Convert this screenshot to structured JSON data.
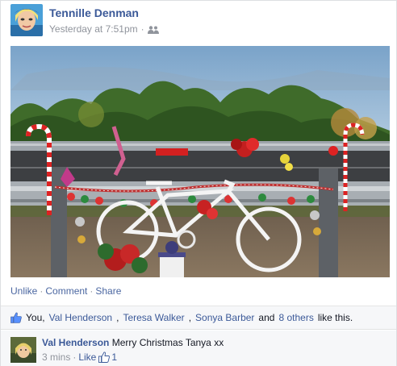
{
  "post": {
    "author": "Tennille Denman",
    "timestamp": "Yesterday at 7:51pm",
    "audience_separator": "·",
    "audience_icon": "friends-icon"
  },
  "actions": {
    "unlike": "Unlike",
    "comment": "Comment",
    "share": "Share",
    "separator": "·"
  },
  "likes": {
    "you": "You,",
    "people": [
      "Val Henderson",
      "Teresa Walker",
      "Sonya Barber"
    ],
    "and": "and",
    "others": "8 others",
    "suffix": "like this."
  },
  "comment": {
    "author": "Val Henderson",
    "text": "Merry Christmas Tanya xx",
    "time": "3 mins",
    "separator": "·",
    "like_label": "Like",
    "like_count": "1"
  },
  "colors": {
    "link": "#3b5998",
    "muted": "#90949c",
    "bar_bg": "#f6f7f9"
  }
}
